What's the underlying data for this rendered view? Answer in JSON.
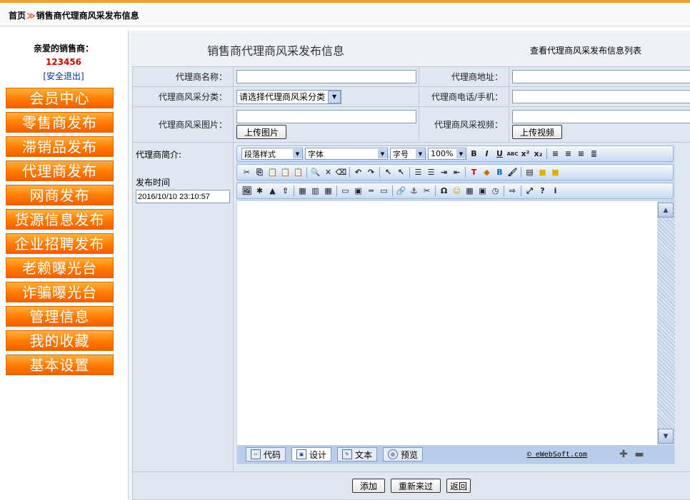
{
  "header": {
    "home": "首页",
    "separator": "≫",
    "current": "销售商代理商风采发布信息"
  },
  "sidebar": {
    "greeting": "亲爱的销售商：",
    "user_id": "123456",
    "logout": "[安全退出]",
    "menu": [
      {
        "label": "会员中心"
      },
      {
        "label": "零售商发布"
      },
      {
        "label": "滞销品发布"
      },
      {
        "label": "代理商发布"
      },
      {
        "label": "网商发布"
      },
      {
        "label": "货源信息发布"
      },
      {
        "label": "企业招聘发布"
      },
      {
        "label": "老赖曝光台"
      },
      {
        "label": "诈骗曝光台"
      },
      {
        "label": "管理信息"
      },
      {
        "label": "我的收藏"
      },
      {
        "label": "基本设置"
      }
    ]
  },
  "main": {
    "title": "销售商代理商风采发布信息",
    "list_link": "查看代理商风采发布信息列表"
  },
  "form": {
    "name_label": "代理商名称：",
    "address_label": "代理商地址：",
    "category_label": "代理商风采分类：",
    "category_value": "请选择代理商风采分类",
    "phone_label": "代理商电话/手机：",
    "image_label": "代理商风采图片：",
    "upload_image": "上传图片",
    "video_label": "代理商风采视频：",
    "upload_video": "上传视频",
    "intro_label": "代理商简介:",
    "publish_time_label": "发布时间",
    "publish_time_value": "2016/10/10 23:10:57"
  },
  "editor": {
    "paragraph_style": "段落样式",
    "font": "字体",
    "font_size": "字号",
    "zoom": "100%",
    "modes": [
      "代码",
      "设计",
      "文本",
      "预览"
    ],
    "active_mode": "设计",
    "copyright": "© eWebSoft.com"
  },
  "actions": {
    "add": "添加",
    "reset": "重新来过",
    "back": "返回"
  }
}
